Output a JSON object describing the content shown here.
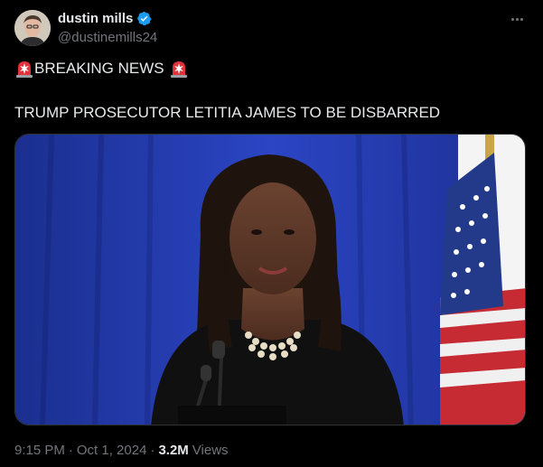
{
  "author": {
    "display_name": "dustin mills",
    "handle": "@dustinemills24",
    "verified": true,
    "avatar_icon": "user-avatar"
  },
  "tweet": {
    "line1_text": "BREAKING NEWS",
    "line1_emoji": "police-siren-icon",
    "line2_text": "TRUMP PROSECUTOR LETITIA JAMES TO BE DISBARRED"
  },
  "meta": {
    "time": "9:15 PM",
    "date": "Oct 1, 2024",
    "separator": "·",
    "views_count": "3.2M",
    "views_label": "Views"
  },
  "colors": {
    "background": "#000000",
    "text_primary": "#e7e9ea",
    "text_secondary": "#71767b",
    "verified_blue": "#1d9bf0",
    "siren_red": "#e0323c"
  }
}
